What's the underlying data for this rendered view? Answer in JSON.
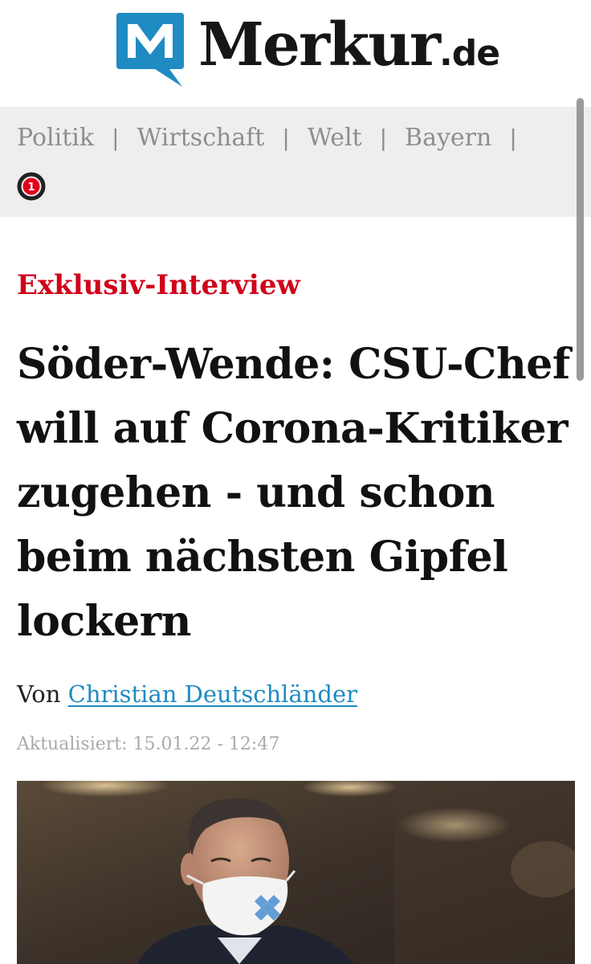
{
  "site": {
    "logo_text": "Merkur",
    "logo_tld": ".de",
    "brand_color": "#1e8bc3"
  },
  "nav": {
    "items": [
      {
        "label": "Politik"
      },
      {
        "label": "Wirtschaft"
      },
      {
        "label": "Welt"
      },
      {
        "label": "Bayern"
      }
    ],
    "separator": "|",
    "live_badge_count": "1"
  },
  "article": {
    "kicker": "Exklusiv-Interview",
    "headline": "Söder-Wende: CSU-Chef will auf Corona-Kritiker zugehen - und schon beim nächsten Gipfel lockern",
    "byline_prefix": "Von",
    "author": "Christian Deutschländer",
    "updated": "Aktualisiert: 15.01.22 - 12:47",
    "kicker_color": "#d0021b"
  },
  "photo": {
    "subject": "man-with-bavarian-ffp2-mask"
  }
}
